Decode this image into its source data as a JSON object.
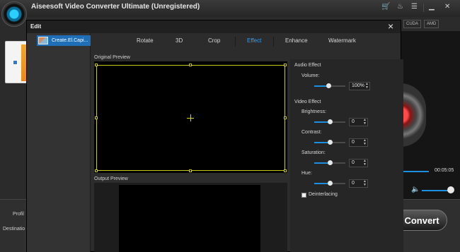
{
  "app": {
    "title": "Aiseesoft Video Converter Ultimate (Unregistered)",
    "toolbar_icons": [
      "cart-icon",
      "key-icon",
      "list-icon",
      "minimize-icon",
      "close-icon"
    ],
    "hw_badges": [
      "CUDA",
      "AMD"
    ],
    "bottom": {
      "profile_label": "Profil",
      "destination_label": "Destinatio"
    },
    "time": "00:05:05",
    "convert_label": "Convert"
  },
  "dialog": {
    "title": "Edit",
    "close_glyph": "×",
    "file_name": "Create.El.Capi...",
    "tabs": [
      {
        "label": "Rotate"
      },
      {
        "label": "3D"
      },
      {
        "label": "Crop"
      },
      {
        "label": "Effect",
        "active": true
      },
      {
        "label": "Enhance"
      },
      {
        "label": "Watermark"
      }
    ],
    "original_preview_label": "Original Preview",
    "output_preview_label": "Output Preview",
    "audio_effect": {
      "title": "Audio Effect",
      "volume_label": "Volume:",
      "volume_value": "100%",
      "volume_level": 0.45
    },
    "video_effect": {
      "title": "Video Effect",
      "brightness": {
        "label": "Brightness:",
        "value": "0",
        "level": 0.5
      },
      "contrast": {
        "label": "Contrast:",
        "value": "0",
        "level": 0.5
      },
      "saturation": {
        "label": "Saturation:",
        "value": "0",
        "level": 0.5
      },
      "hue": {
        "label": "Hue:",
        "value": "0",
        "level": 0.5
      },
      "deinterlacing_label": "Deinterlacing",
      "deinterlacing_checked": false
    }
  },
  "colors": {
    "accent": "#1c8fe0",
    "active_tab": "#2aa3ff",
    "crop_frame": "#c8c81a",
    "file_selected": "#1f6fb8"
  }
}
